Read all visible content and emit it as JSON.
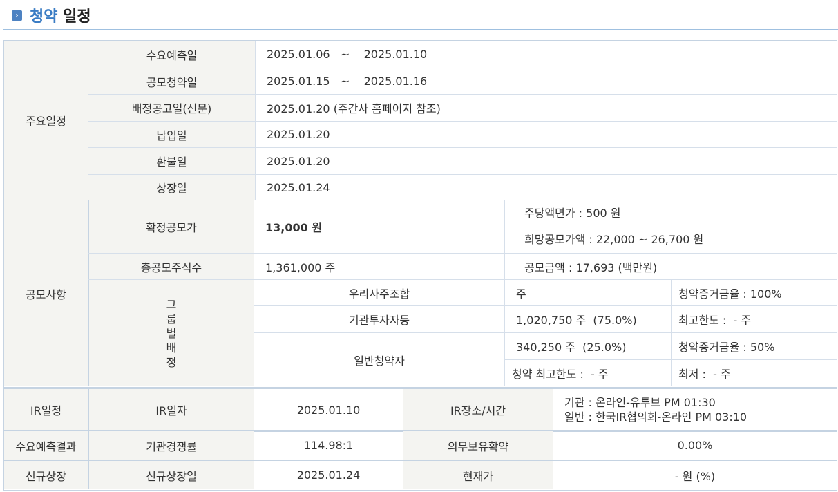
{
  "title": {
    "part1": "청약",
    "part2": "일정"
  },
  "schedule": {
    "section_label": "주요일정",
    "rows": [
      {
        "label": "수요예측일",
        "value": "2025.01.06   ~    2025.01.10"
      },
      {
        "label": "공모청약일",
        "value": "2025.01.15   ~    2025.01.16"
      },
      {
        "label": "배정공고일(신문)",
        "value": "2025.01.20 (주간사 홈페이지 참조)"
      },
      {
        "label": "납입일",
        "value": "2025.01.20"
      },
      {
        "label": "환불일",
        "value": "2025.01.20"
      },
      {
        "label": "상장일",
        "value": "2025.01.24"
      }
    ]
  },
  "offering": {
    "section_label": "공모사항",
    "confirmed_price_label": "확정공모가",
    "confirmed_price_value": "13,000 원",
    "face_value": "주당액면가 :  500 원",
    "desired_price": "희망공모가액 :  22,000 ~ 26,700 원",
    "total_shares_label": "총공모주식수",
    "total_shares_value": "1,361,000 주",
    "total_amount": "공모금액 : 17,693 (백만원)",
    "group_label": [
      "그",
      "룹",
      "별",
      "배",
      "정"
    ],
    "groups": {
      "employee": {
        "name": "우리사주조합",
        "shares": "주",
        "note": "청약증거금율 : 100%"
      },
      "institution": {
        "name": "기관투자자등",
        "shares": "1,020,750 주  (75.0%)",
        "note": "최고한도 :  - 주"
      },
      "retail": {
        "name": "일반청약자",
        "shares": "340,250 주  (25.0%)",
        "note": "청약증거금율 : 50%",
        "max": "청약 최고한도 :  - 주",
        "min": "최저 :  - 주"
      }
    }
  },
  "ir": {
    "section_label": "IR일정",
    "date_label": "IR일자",
    "date_value": "2025.01.10",
    "place_label": "IR장소/시간",
    "place_line1": "기관 : 온라인-유투브 PM 01:30",
    "place_line2": "일반 : 한국IR협의회-온라인 PM 03:10"
  },
  "demand": {
    "section_label": "수요예측결과",
    "competition_label": "기관경쟁률",
    "competition_value": "114.98:1",
    "lockup_label": "의무보유확약",
    "lockup_value": "0.00%"
  },
  "listing": {
    "section_label": "신규상장",
    "date_label": "신규상장일",
    "date_value": "2025.01.24",
    "price_label": "현재가",
    "price_value": "- 원 (%)"
  }
}
